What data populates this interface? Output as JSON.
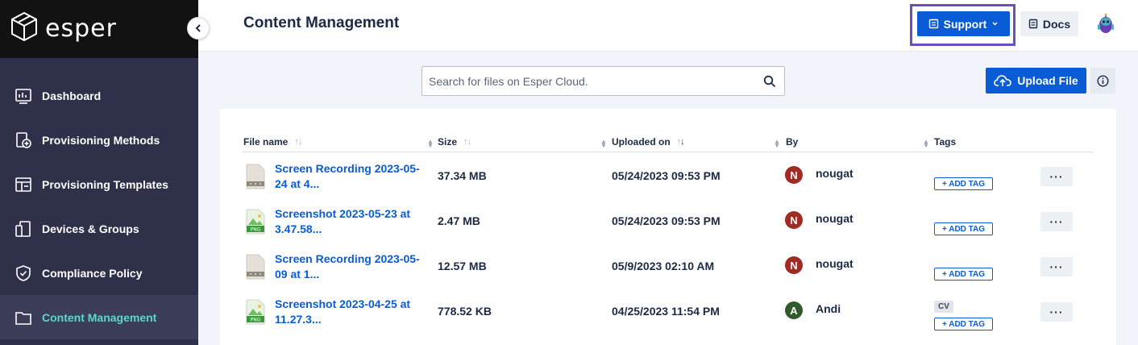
{
  "brand": {
    "name": "esper"
  },
  "sidebar": {
    "items": [
      {
        "label": "Dashboard",
        "icon": "dashboard-icon"
      },
      {
        "label": "Provisioning Methods",
        "icon": "provisioning-methods-icon"
      },
      {
        "label": "Provisioning Templates",
        "icon": "provisioning-templates-icon"
      },
      {
        "label": "Devices & Groups",
        "icon": "devices-icon"
      },
      {
        "label": "Compliance Policy",
        "icon": "shield-icon"
      },
      {
        "label": "Content Management",
        "icon": "folder-icon",
        "active": true
      }
    ]
  },
  "header": {
    "title": "Content Management",
    "support_label": "Support",
    "docs_label": "Docs"
  },
  "toolbar": {
    "search_placeholder": "Search for files on Esper Cloud.",
    "upload_label": "Upload File"
  },
  "table": {
    "columns": [
      "File name",
      "Size",
      "Uploaded on",
      "By",
      "Tags"
    ],
    "add_tag_label": "+ ADD TAG",
    "more_label": "···",
    "rows": [
      {
        "file_type": "video",
        "name_line1": "Screen Recording 2023-05-",
        "name_line2": "24 at 4...",
        "size": "37.34 MB",
        "uploaded": "05/24/2023 09:53 PM",
        "by_initial": "N",
        "by": "nougat",
        "tags": []
      },
      {
        "file_type": "png",
        "name_line1": "Screenshot 2023-05-23 at",
        "name_line2": "3.47.58...",
        "size": "2.47 MB",
        "uploaded": "05/24/2023 09:53 PM",
        "by_initial": "N",
        "by": "nougat",
        "tags": []
      },
      {
        "file_type": "video",
        "name_line1": "Screen Recording 2023-05-",
        "name_line2": "09 at 1...",
        "size": "12.57 MB",
        "uploaded": "05/9/2023 02:10 AM",
        "by_initial": "N",
        "by": "nougat",
        "tags": []
      },
      {
        "file_type": "png",
        "name_line1": "Screenshot 2023-04-25 at",
        "name_line2": "11.27.3...",
        "size": "778.52 KB",
        "uploaded": "04/25/2023 11:54 PM",
        "by_initial": "A",
        "by": "Andi",
        "tags": [
          "CV"
        ]
      }
    ]
  },
  "colors": {
    "primary": "#0a5cd6",
    "sidebar_bg": "#2f3049",
    "active_text": "#5ed6c8",
    "highlight_outline": "#6b4fbf",
    "avatar_n": "#a12a22",
    "avatar_a": "#2f5a2a"
  }
}
